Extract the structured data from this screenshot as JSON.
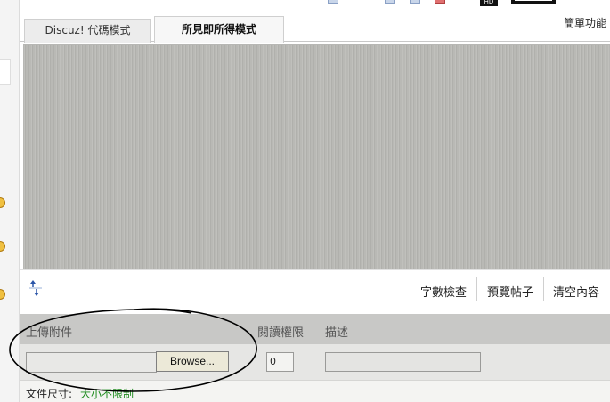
{
  "toolbar": {
    "hd_badge": "HD",
    "simple_function": "簡單功能"
  },
  "tabs": [
    {
      "label": "Discuz! 代碼模式",
      "active": false
    },
    {
      "label": "所見即所得模式",
      "active": true
    }
  ],
  "editor_actions": {
    "word_count": "字數檢查",
    "preview": "預覽帖子",
    "clear": "清空內容"
  },
  "attachment": {
    "upload_label": "上傳附件",
    "permission_label": "閱讀權限",
    "description_label": "描述",
    "browse_button": "Browse...",
    "permission_value": "0",
    "file_size_label": "文件尺寸:",
    "file_size_value": "大小不限制"
  },
  "colors": {
    "editor_background": "#b9b9b5",
    "annotation_stroke": "#000000",
    "size_value": "#1c8a1c"
  }
}
